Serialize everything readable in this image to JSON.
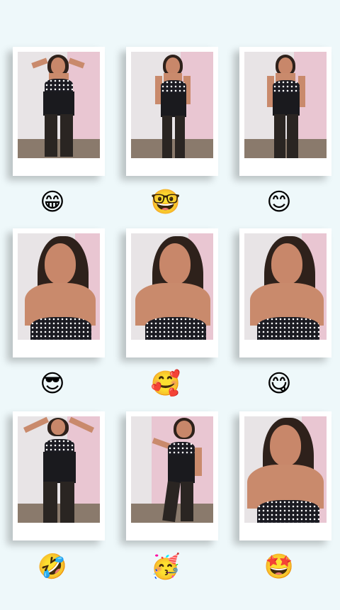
{
  "cells": [
    {
      "photo": "full-body-standing",
      "emoji": "😁",
      "emoji_name": "grinning-face-icon"
    },
    {
      "photo": "full-body-standing",
      "emoji": "🤓",
      "emoji_name": "nerd-face-icon"
    },
    {
      "photo": "full-body-standing",
      "emoji": "😊",
      "emoji_name": "smiling-face-icon"
    },
    {
      "photo": "selfie-closeup",
      "emoji": "😎",
      "emoji_name": "sunglasses-face-icon"
    },
    {
      "photo": "selfie-closeup",
      "emoji": "🥰",
      "emoji_name": "smiling-face-hearts-icon"
    },
    {
      "photo": "selfie-closeup",
      "emoji": "😋",
      "emoji_name": "savoring-face-icon"
    },
    {
      "photo": "full-body-arms-up",
      "emoji": "🤣",
      "emoji_name": "rolling-laughing-icon"
    },
    {
      "photo": "full-body-dancing",
      "emoji": "🥳",
      "emoji_name": "party-face-icon"
    },
    {
      "photo": "selfie-closeup",
      "emoji": "🤩",
      "emoji_name": "star-struck-icon"
    }
  ],
  "colors": {
    "background": "#eef8fa",
    "frame": "#ffffff",
    "wall_pink": "#e9c6d2"
  }
}
